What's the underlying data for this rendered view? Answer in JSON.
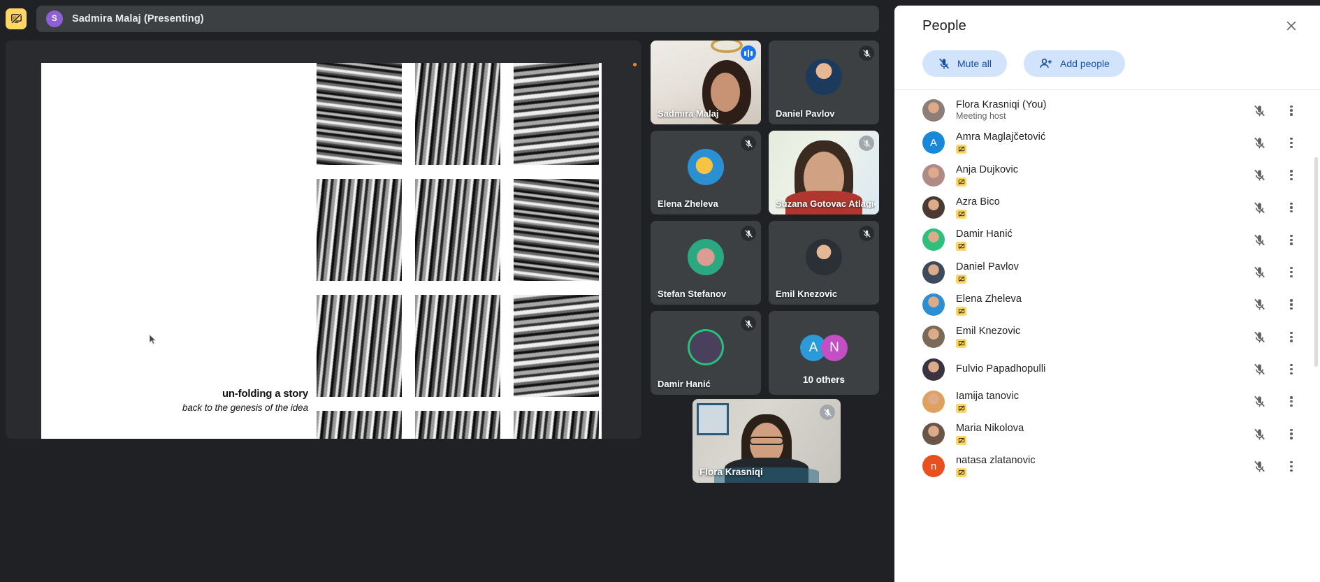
{
  "topbar": {
    "present_toggle_icon": "stop-presenting-icon",
    "presenter_initial": "S",
    "presenter_banner": "Sadmira Malaj (Presenting)"
  },
  "slide": {
    "title": "un-folding a story",
    "subtitle": "back to the genesis of the idea"
  },
  "tiles": [
    {
      "name": "Sadmira Malaj",
      "type": "video",
      "active": true,
      "speaking": true,
      "muted": false
    },
    {
      "name": "Daniel Pavlov",
      "type": "avatar",
      "active": false,
      "speaking": false,
      "muted": true,
      "avatar_color": "#1b3a5c"
    },
    {
      "name": "Elena Zheleva",
      "type": "avatar",
      "active": false,
      "speaking": false,
      "muted": true,
      "avatar_color": "#2b8fd4"
    },
    {
      "name": "Suzana Gotovac Atlagic",
      "type": "video",
      "active": false,
      "speaking": false,
      "muted": true
    },
    {
      "name": "Stefan Stefanov",
      "type": "avatar",
      "active": false,
      "speaking": false,
      "muted": true,
      "avatar_color": "#2aa87f"
    },
    {
      "name": "Emil Knezovic",
      "type": "avatar",
      "active": false,
      "speaking": false,
      "muted": true,
      "avatar_color": "#7b6a58"
    },
    {
      "name": "Damir Hanić",
      "type": "avatar",
      "active": false,
      "speaking": false,
      "muted": true,
      "avatar_color": "#25c27a"
    }
  ],
  "others_tile": {
    "label": "10 others",
    "avatars": [
      {
        "initial": "A",
        "color": "#2a9bd8"
      },
      {
        "initial": "N",
        "color": "#c councillor"
      }
    ]
  },
  "others_avatars": [
    {
      "initial": "A",
      "color": "#2a9bd8"
    },
    {
      "initial": "N",
      "color": "#c44fc4"
    }
  ],
  "selfview": {
    "name": "Flora Krasniqi",
    "muted": true
  },
  "people_panel": {
    "title": "People",
    "close_label": "Close",
    "mute_all_label": "Mute all",
    "add_people_label": "Add people",
    "participants": [
      {
        "name": "Flora Krasniqi (You)",
        "sub": "Meeting host",
        "badge": false,
        "muted": true,
        "avatar_type": "photo",
        "avatar_color": "#8d7f77"
      },
      {
        "name": "Amra Maglajčetović",
        "sub": "",
        "badge": true,
        "muted": true,
        "avatar_type": "initial",
        "initial": "A",
        "avatar_color": "#1a88d8"
      },
      {
        "name": "Anja Dujkovic",
        "sub": "",
        "badge": true,
        "muted": true,
        "avatar_type": "photo",
        "avatar_color": "#b08a84"
      },
      {
        "name": "Azra Bico",
        "sub": "",
        "badge": true,
        "muted": true,
        "avatar_type": "photo",
        "avatar_color": "#4a3a33"
      },
      {
        "name": "Damir Hanić",
        "sub": "",
        "badge": true,
        "muted": true,
        "avatar_type": "photo",
        "avatar_color": "#2ec07c"
      },
      {
        "name": "Daniel Pavlov",
        "sub": "",
        "badge": true,
        "muted": true,
        "avatar_type": "photo",
        "avatar_color": "#3d4a5c"
      },
      {
        "name": "Elena Zheleva",
        "sub": "",
        "badge": true,
        "muted": true,
        "avatar_type": "photo",
        "avatar_color": "#2b8fd4"
      },
      {
        "name": "Emil Knezovic",
        "sub": "",
        "badge": true,
        "muted": true,
        "avatar_type": "photo",
        "avatar_color": "#7b6a58"
      },
      {
        "name": "Fulvio Papadhopulli",
        "sub": "",
        "badge": false,
        "muted": true,
        "avatar_type": "photo",
        "avatar_color": "#3b3440"
      },
      {
        "name": "Iamija tanovic",
        "sub": "",
        "badge": true,
        "muted": true,
        "avatar_type": "photo",
        "avatar_color": "#e0a060"
      },
      {
        "name": "Maria Nikolova",
        "sub": "",
        "badge": true,
        "muted": true,
        "avatar_type": "photo",
        "avatar_color": "#6b5548"
      },
      {
        "name": "natasa zlatanovic",
        "sub": "",
        "badge": true,
        "muted": true,
        "avatar_type": "initial",
        "initial": "n",
        "avatar_color": "#e8501f"
      }
    ]
  },
  "colors": {
    "app_background": "#202124",
    "tile_background": "#3c4043",
    "accent_blue": "#8ab4f8",
    "pill_background": "#d2e3fc",
    "pill_text": "#174ea6",
    "badge_yellow": "#fdd663",
    "panel_background": "#ffffff"
  }
}
